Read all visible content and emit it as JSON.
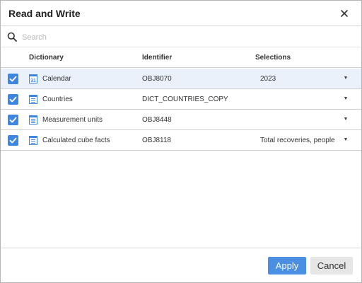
{
  "dialog": {
    "title": "Read and Write"
  },
  "search": {
    "placeholder": "Search",
    "value": ""
  },
  "columns": {
    "dictionary": "Dictionary",
    "identifier": "Identifier",
    "selections": "Selections"
  },
  "rows": [
    {
      "name": "Calendar",
      "identifier": "OBJ8070",
      "selection": "2023",
      "checked": true,
      "icon": "calendar-icon"
    },
    {
      "name": "Countries",
      "identifier": "DICT_COUNTRIES_COPY",
      "selection": "",
      "checked": true,
      "icon": "dictionary-icon"
    },
    {
      "name": "Measurement units",
      "identifier": "OBJ8448",
      "selection": "",
      "checked": true,
      "icon": "dictionary-icon"
    },
    {
      "name": "Calculated cube facts",
      "identifier": "OBJ8118",
      "selection": "Total recoveries, people",
      "checked": true,
      "icon": "dictionary-icon"
    }
  ],
  "footer": {
    "apply_label": "Apply",
    "cancel_label": "Cancel"
  },
  "colors": {
    "accent": "#4a8fe3",
    "checkbox": "#3d87e3",
    "selected_row": "#eaf1fb"
  }
}
